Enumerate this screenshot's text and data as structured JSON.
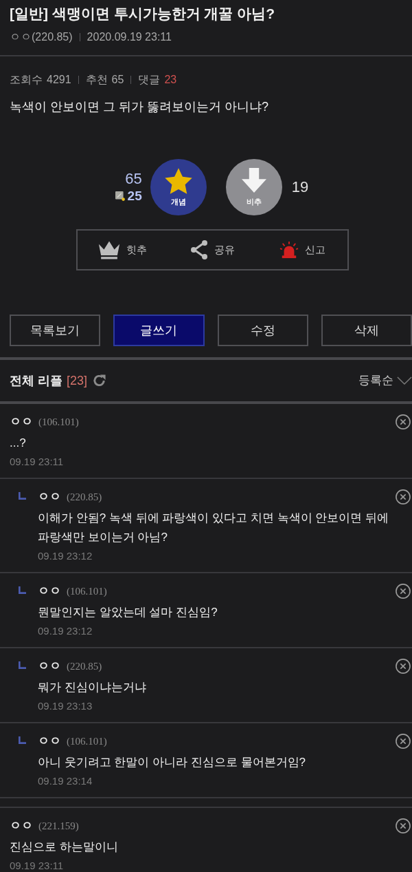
{
  "post": {
    "title": "[일반] 색맹이면 투시가능한거 개꿀 아님?",
    "author": "ㅇㅇ(220.85)",
    "date": "2020.09.19 23:11",
    "stats": [
      {
        "label": "조회수",
        "value": "4291",
        "highlight": false
      },
      {
        "label": "추천",
        "value": "65",
        "highlight": false
      },
      {
        "label": "댓글",
        "value": "23",
        "highlight": true
      }
    ],
    "body": "녹색이 안보이면 그 뒤가 뚫려보이는거 아니냐?"
  },
  "vote": {
    "up_count": "65",
    "fixed_count": "25",
    "up_label": "개념",
    "down_label": "비추",
    "down_count": "19"
  },
  "actions": [
    {
      "kind": "crown",
      "label": "힛추"
    },
    {
      "kind": "share",
      "label": "공유"
    },
    {
      "kind": "siren",
      "label": "신고"
    }
  ],
  "buttons": [
    {
      "label": "목록보기",
      "primary": false
    },
    {
      "label": "글쓰기",
      "primary": true
    },
    {
      "label": "수정",
      "primary": false
    },
    {
      "label": "삭제",
      "primary": false
    }
  ],
  "comments_header": {
    "title": "전체 리플",
    "count": "[23]",
    "sort": "등록순"
  },
  "comments": [
    {
      "author": "ㅇㅇ",
      "ip": "(106.101)",
      "text": "...?",
      "date": "09.19 23:11",
      "children": [
        {
          "author": "ㅇㅇ",
          "ip": "(220.85)",
          "text": "이해가 안됨? 녹색 뒤에 파랑색이 있다고 치면 녹색이 안보이면 뒤에 파랑색만 보이는거 아님?",
          "date": "09.19 23:12"
        },
        {
          "author": "ㅇㅇ",
          "ip": "(106.101)",
          "text": "뭔말인지는 알았는데 설마 진심임?",
          "date": "09.19 23:12"
        },
        {
          "author": "ㅇㅇ",
          "ip": "(220.85)",
          "text": "뭐가 진심이냐는거냐",
          "date": "09.19 23:13"
        },
        {
          "author": "ㅇㅇ",
          "ip": "(106.101)",
          "text": "아니 웃기려고 한말이 아니라 진심으로 물어본거임?",
          "date": "09.19 23:14"
        }
      ]
    },
    {
      "author": "ㅇㅇ",
      "ip": "(221.159)",
      "text": "진심으로 하는말이니",
      "date": "09.19 23:11"
    }
  ]
}
